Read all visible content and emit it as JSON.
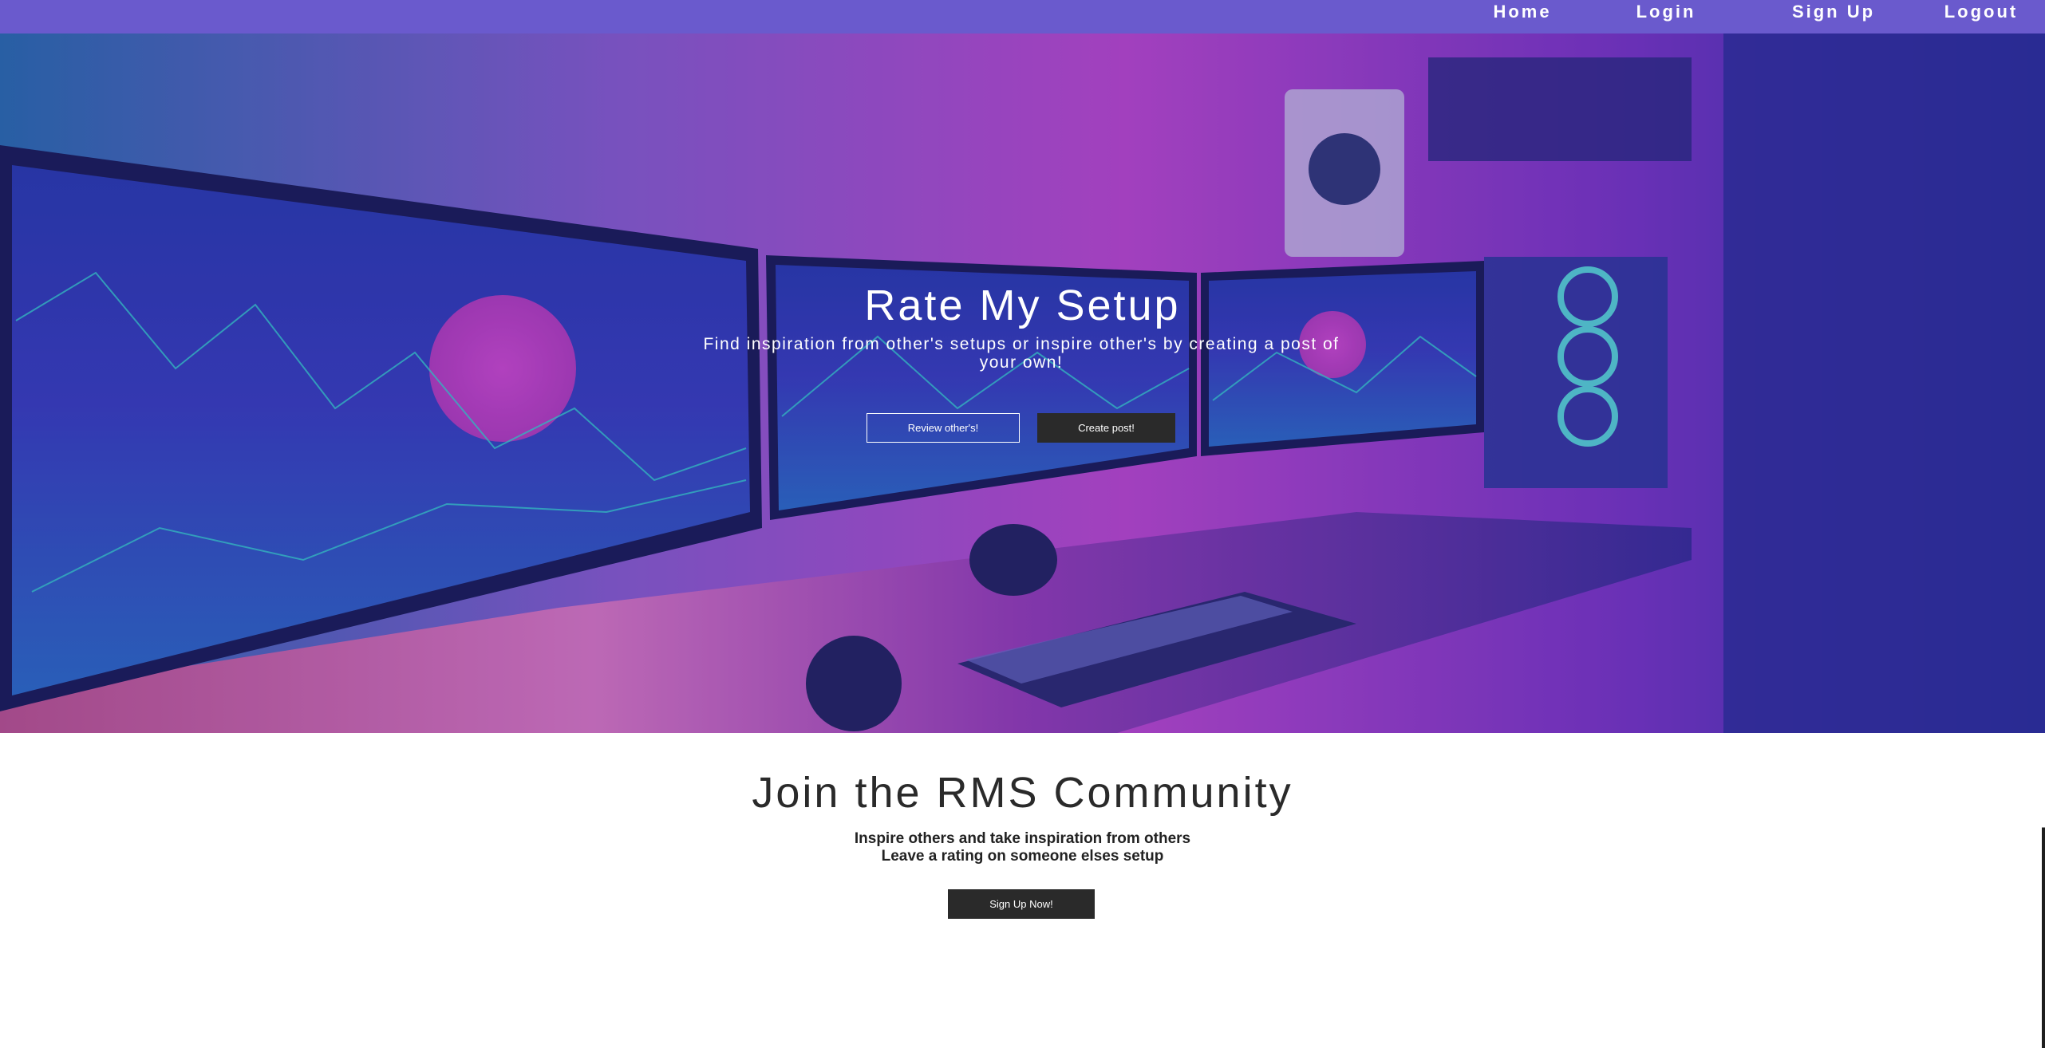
{
  "navbar": {
    "background": "#6a5acd",
    "links": [
      {
        "label": "Home"
      },
      {
        "label": "Login"
      },
      {
        "label": "Sign Up"
      },
      {
        "label": "Logout"
      }
    ]
  },
  "hero": {
    "image_description_icon": "desk-setup-image",
    "title": "Rate My Setup",
    "subtitle": "Find inspiration from other's setups or inspire other's by creating a post of your own!",
    "review_button": "Review other's!",
    "create_button": "Create post!"
  },
  "community": {
    "title": "Join the RMS Community",
    "line1": "Inspire others and take inspiration from others",
    "line2": "Leave a rating on someone elses setup",
    "signup_button": "Sign Up Now!"
  },
  "colors": {
    "button_dark": "#2a2a2a",
    "text_dark": "#2a2a2a"
  }
}
